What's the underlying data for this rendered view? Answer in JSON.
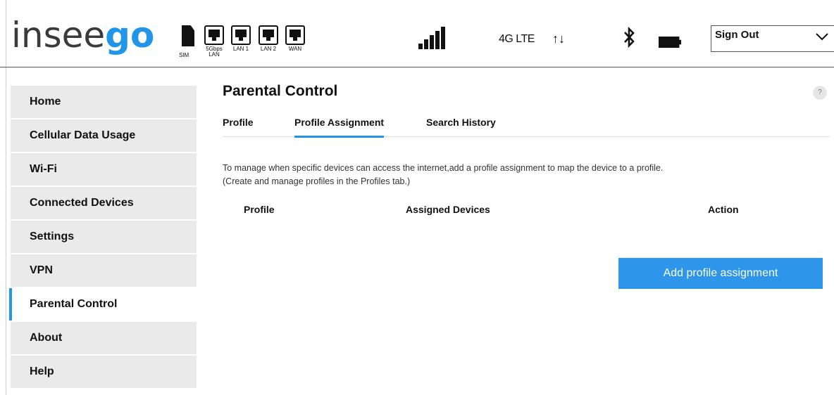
{
  "header": {
    "logo": {
      "main": "insee",
      "accent": "go"
    },
    "ports": [
      {
        "icon": "sim-icon",
        "label": "SIM"
      },
      {
        "icon": "ethernet-port-icon",
        "label": "5Gbps LAN"
      },
      {
        "icon": "ethernet-port-icon",
        "label": "LAN 1"
      },
      {
        "icon": "ethernet-port-icon",
        "label": "LAN 2"
      },
      {
        "icon": "ethernet-port-icon",
        "label": "WAN"
      }
    ],
    "signal_icon": "signal-bars-icon",
    "network_type": "4G LTE",
    "data_arrows": "↑↓",
    "bluetooth_icon": "bluetooth-icon",
    "battery_icon": "battery-icon",
    "signout": {
      "label": "Sign Out",
      "icon": "chevron-down-icon"
    }
  },
  "sidebar": {
    "items": [
      {
        "label": "Home"
      },
      {
        "label": "Cellular Data Usage"
      },
      {
        "label": "Wi-Fi"
      },
      {
        "label": "Connected Devices"
      },
      {
        "label": "Settings"
      },
      {
        "label": "VPN"
      },
      {
        "label": "Parental Control",
        "active": true
      },
      {
        "label": "About"
      },
      {
        "label": "Help"
      }
    ]
  },
  "main": {
    "title": "Parental Control",
    "help_icon": "question-mark-icon",
    "help_text": "?",
    "tabs": [
      {
        "label": "Profile"
      },
      {
        "label": "Profile Assignment",
        "active": true
      },
      {
        "label": "Search History"
      }
    ],
    "description_line1": "To manage when specific devices can access the internet,add a profile assignment to map the device to a profile.",
    "description_line2": "(Create and manage profiles in the Profiles tab.)",
    "table": {
      "columns": [
        "Profile",
        "Assigned Devices",
        "Action"
      ]
    },
    "add_button": "Add profile assignment"
  },
  "colors": {
    "accent": "#2196e8",
    "button": "#2d95ea",
    "nav_bg": "#eaeaea"
  }
}
